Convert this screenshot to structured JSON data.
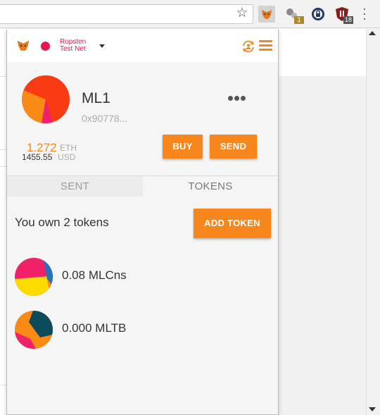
{
  "browser": {
    "extensions": [
      {
        "name": "metamask-extension",
        "badge": ""
      },
      {
        "name": "extension-1",
        "badge": "1"
      },
      {
        "name": "extension-2",
        "badge": ""
      },
      {
        "name": "extension-3",
        "badge": "18"
      }
    ]
  },
  "network": {
    "name_line1": "Ropsten",
    "name_line2": "Test Net",
    "color": "#e91550"
  },
  "account": {
    "name": "ML1",
    "address": "0x90778..."
  },
  "balance": {
    "eth_value": "1.272",
    "eth_unit": "ETH",
    "usd_value": "1455.55",
    "usd_unit": "USD"
  },
  "actions": {
    "buy_label": "BUY",
    "send_label": "SEND"
  },
  "tabs": {
    "sent_label": "SENT",
    "tokens_label": "TOKENS",
    "active": "TOKENS"
  },
  "tokens": {
    "summary": "You own 2 tokens",
    "add_token_label": "ADD TOKEN",
    "items": [
      {
        "amount": "0.08",
        "symbol": "MLCns"
      },
      {
        "amount": "0.000",
        "symbol": "MLTB"
      }
    ]
  },
  "colors": {
    "accent": "#f7861c",
    "network": "#e91550"
  }
}
